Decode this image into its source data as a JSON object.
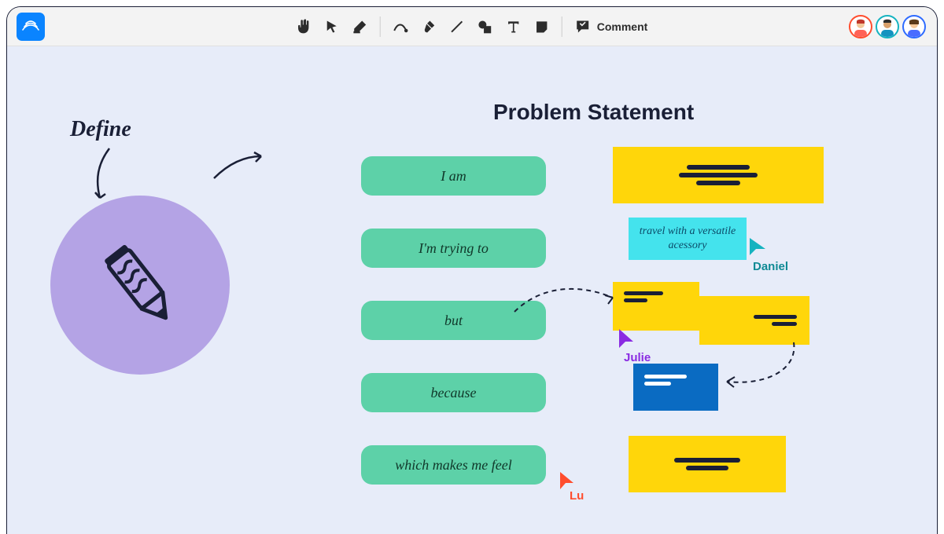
{
  "toolbar": {
    "comment_label": "Comment"
  },
  "collaborators": [
    {
      "name": "Lu",
      "color": "#ff4d2e"
    },
    {
      "name": "Daniel",
      "color": "#15b3c0"
    },
    {
      "name": "Julie",
      "color": "#8a2be2"
    }
  ],
  "canvas": {
    "define_label": "Define",
    "title": "Problem Statement",
    "prompts": [
      "I am",
      "I'm trying to",
      "but",
      "because",
      "which makes me feel"
    ],
    "cyan_note_text": "travel with a versatile acessory"
  },
  "cursors": {
    "daniel": "Daniel",
    "julie": "Julie",
    "lu": "Lu"
  }
}
